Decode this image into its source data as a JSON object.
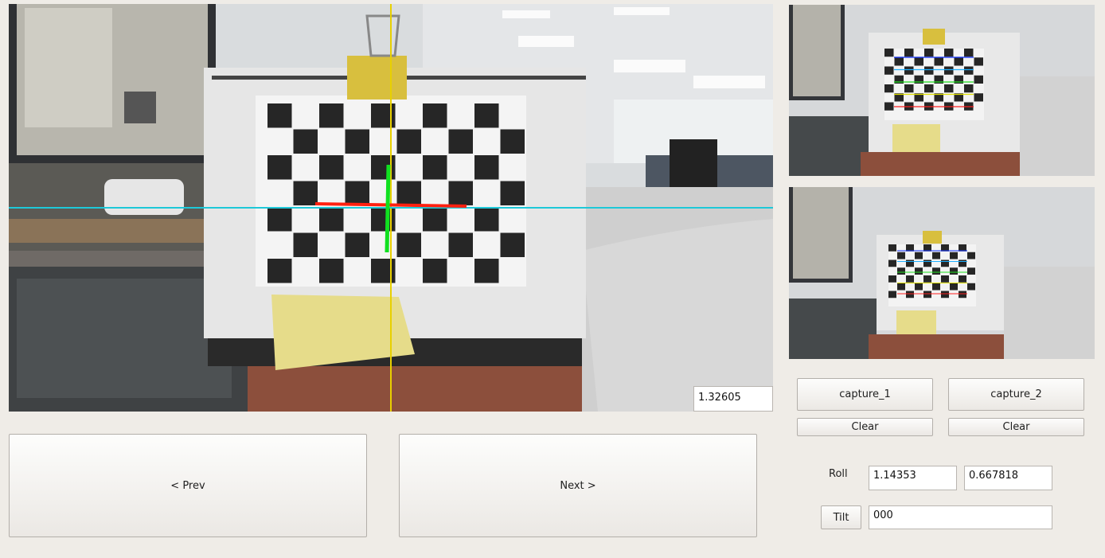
{
  "main_view": {
    "value": "1.32605",
    "guides": {
      "vertical_color": "#e8d000",
      "horizontal_color": "#1ec8d8"
    },
    "axes": {
      "x_color": "#ff2010",
      "y_color": "#10e020"
    }
  },
  "thumbnails": [
    {
      "name": "capture-1-preview",
      "corner_colors": [
        "#1030ff",
        "#20b0ff",
        "#20e020",
        "#e0e000",
        "#ff2020"
      ]
    },
    {
      "name": "capture-2-preview",
      "corner_colors": [
        "#1030ff",
        "#20b0ff",
        "#20e020",
        "#e0e000",
        "#ff2020"
      ]
    }
  ],
  "navigation": {
    "prev_label": "< Prev",
    "next_label": "Next >"
  },
  "captures": [
    {
      "label": "capture_1",
      "clear_label": "Clear"
    },
    {
      "label": "capture_2",
      "clear_label": "Clear"
    }
  ],
  "roll": {
    "label": "Roll",
    "value_1": "1.14353",
    "value_2": "0.667818"
  },
  "tilt": {
    "label": "Tilt",
    "value": "000"
  }
}
